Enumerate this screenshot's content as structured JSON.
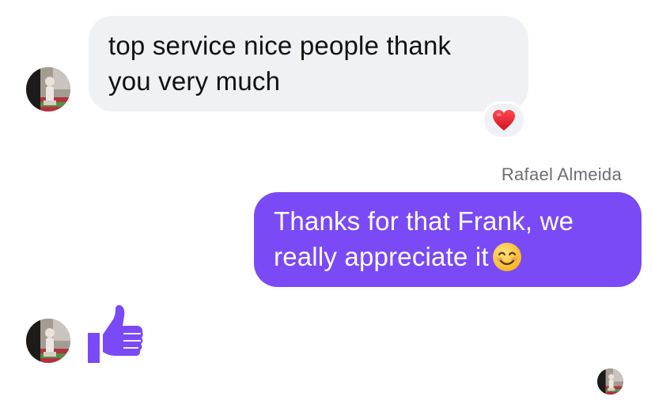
{
  "messages": [
    {
      "direction": "incoming",
      "text": "top service nice people thank you very much",
      "line1": "top service nice people thank",
      "line2": "you very much",
      "reaction_icon": "red-heart"
    },
    {
      "direction": "outgoing",
      "sender": "Rafael Almeida",
      "line1": "Thanks for that Frank, we",
      "line2": "really appreciate it",
      "emoji_icon": "smiling-face-emoji"
    },
    {
      "direction": "incoming",
      "sticker_icon": "thumbs-up-icon"
    }
  ],
  "colors": {
    "incoming_bubble": "#f0f1f4",
    "outgoing_bubble": "#7a4af6",
    "like": "#7a4af6",
    "sender_label": "#6d6d72",
    "heart": "#e0202e"
  },
  "seen_indicator": "avatar"
}
